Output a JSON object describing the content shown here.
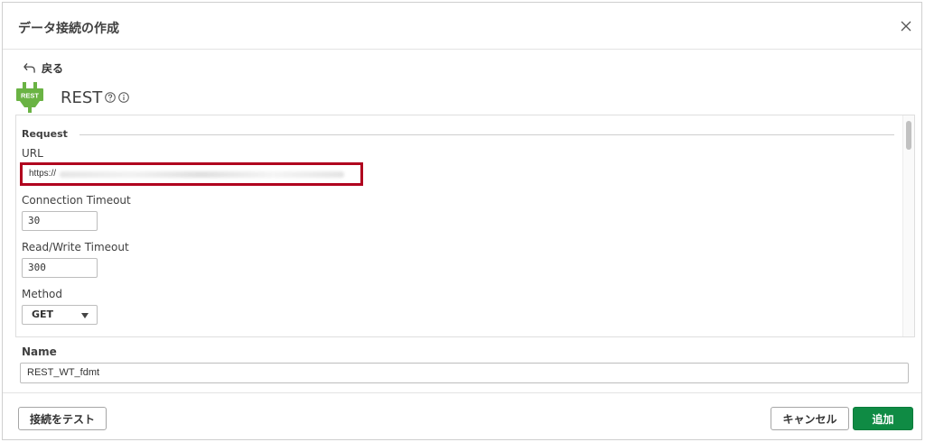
{
  "dialog": {
    "title": "データ接続の作成"
  },
  "back": {
    "label": "戻る"
  },
  "connector": {
    "logo_text": "REST",
    "name": "REST",
    "brand_color": "#6ab344"
  },
  "form": {
    "section_title": "Request",
    "url": {
      "label": "URL",
      "value": "https://"
    },
    "connection_timeout": {
      "label": "Connection Timeout",
      "value": "30"
    },
    "read_write_timeout": {
      "label": "Read/Write Timeout",
      "value": "300"
    },
    "method": {
      "label": "Method",
      "value": "GET"
    }
  },
  "name_field": {
    "label": "Name",
    "value": "REST_WT_fdmt"
  },
  "buttons": {
    "test": "接続をテスト",
    "cancel": "キャンセル",
    "add": "追加"
  },
  "colors": {
    "accent_green": "#0f8b44",
    "highlight_red": "#b0001e"
  }
}
